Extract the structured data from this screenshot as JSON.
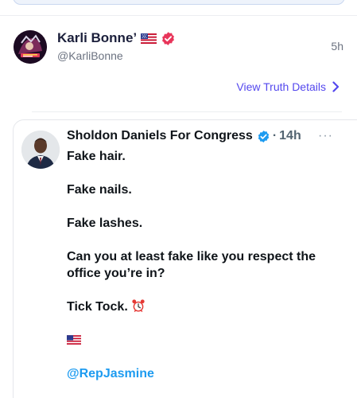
{
  "truth": {
    "display_name": "Karli Bonne’",
    "handle": "@KarliBonne",
    "time": "5h",
    "view_details_label": "View Truth Details"
  },
  "embedded_post": {
    "author": "Sholdon Daniels For Congress",
    "separator": "·",
    "time": "14h",
    "more_label": "···",
    "lines": {
      "l1": "Fake hair.",
      "l2": "Fake nails.",
      "l3": "Fake lashes.",
      "l4": "Can you at least fake like you respect the office you’re in?",
      "l5": "Tick Tock.",
      "mention": "@RepJasmine"
    }
  },
  "icons": {
    "truth_verified": "red-verified-badge-icon",
    "embed_verified": "blue-verified-badge-icon",
    "flag": "us-flag-icon",
    "alarm": "alarm-clock-icon",
    "chevron": "chevron-right-icon"
  },
  "colors": {
    "link": "#5448ee",
    "mention": "#1d9bf0",
    "verified_red": "#e8355a",
    "verified_blue": "#1d9bf0"
  }
}
